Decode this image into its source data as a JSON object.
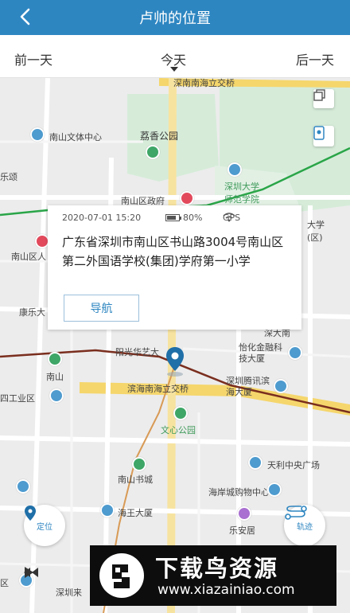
{
  "header": {
    "title": "卢帅的位置"
  },
  "days": {
    "prev": "前一天",
    "current": "今天",
    "next": "后一天"
  },
  "popup": {
    "datetime": "2020-07-01 15:20",
    "battery": "80%",
    "battery_level": 0.8,
    "signal": "GPS",
    "address": "广东省深圳市南山区书山路3004号南山区第二外国语学校(集团)学府第一小学",
    "nav_label": "导航"
  },
  "map_labels": {
    "road_top": "深南南海立交桥",
    "park": "荔香公园",
    "sports_center": "南山文体中心",
    "lesong": "乐颂",
    "university": "深圳大学师范学院",
    "district_gov": "南山区政府",
    "nanshan_people": "南山区人",
    "kangle": "康乐大",
    "university_right": "大学(区)",
    "yangguang": "阳光华艺大",
    "shenda_nan": "深大南",
    "yihua": "怡化金融科技大厦",
    "nanshan_station": "南山",
    "industrial": "四工业区",
    "binhai_bridge": "滨海南海立交桥",
    "tencent": "深圳腾讯滨海大厦",
    "wenxin_park": "文心公园",
    "tianli": "天利中央广场",
    "book_city": "南山书城",
    "coastal_mall": "海岸城购物中心",
    "haiwang": "海王大厦",
    "lean": "乐安居",
    "shenzhen_lai": "深圳来",
    "left_edge": "区"
  },
  "controls": {
    "locate_label": "定位",
    "track_label": "轨迹"
  },
  "watermark": {
    "brand": "下载鸟资源",
    "url": "www.xiazainiao.com"
  },
  "colors": {
    "header": "#2e86c1",
    "accent": "#2e86c1",
    "route": "#2aa548",
    "rail": "#7a2e1e",
    "highway": "#f5d66c"
  }
}
